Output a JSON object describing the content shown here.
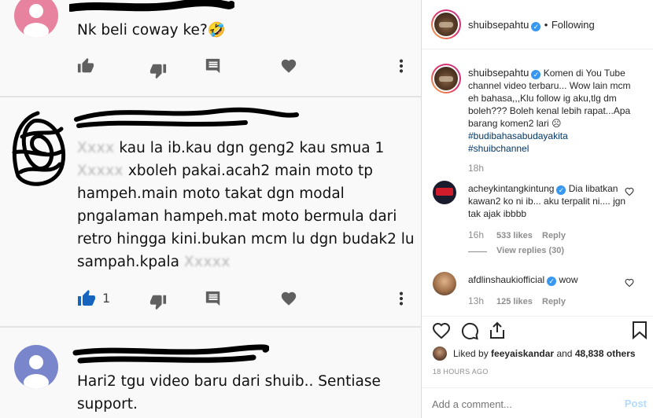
{
  "youtube": {
    "comments": [
      {
        "text": "Nk beli coway ke?",
        "emoji": "🤣"
      },
      {
        "text_parts": [
          "kau la ib.kau dgn geng2 kau smua 1",
          "xboleh pakai.acah2 main moto tp",
          "hampeh.main moto takat dgn modal",
          "pngalaman hampeh.mat moto bermula dari",
          "retro hingga kini.bukan mcm lu dgn budak2 lu",
          "sampah.kpala"
        ],
        "like_count": "1"
      },
      {
        "text": "Hari2 tgu video baru dari shuib.. Sentiase support."
      }
    ],
    "icons": {
      "like": "thumbs-up-icon",
      "dislike": "thumbs-down-icon",
      "reply": "comment-icon",
      "heart": "heart-icon",
      "menu": "more-vertical-icon"
    },
    "colors": {
      "like_active": "#1565c0",
      "icon_grey": "#606060"
    }
  },
  "instagram": {
    "header": {
      "username": "shuibsepahtu",
      "follow_separator": "•",
      "follow_status": "Following"
    },
    "caption": {
      "username": "shuibsepahtu",
      "text": "Komen di You Tube channel video terbaru... Wow lain mcm eh bahasa,,,Klu follow ig aku,tlg dm boleh??? Boleh kenal lebih rapat...Apa barang komen2 lari ☹",
      "hashtags": [
        "#budibahasabudayakita",
        "#shuibchannel"
      ],
      "time": "18h"
    },
    "comments": [
      {
        "username": "acheykintangkintung",
        "text": "Dia libatkan kawan2 ko ni ib... aku terpalit ni.... jgn tak ajak ibbbb",
        "time": "16h",
        "likes": "533 likes",
        "reply": "Reply",
        "view_replies": "View replies (30)"
      },
      {
        "username": "afdlinshaukiofficial",
        "text": "wow",
        "time": "13h",
        "likes": "125 likes",
        "reply": "Reply"
      }
    ],
    "liked_by": {
      "prefix": "Liked by",
      "user": "feeyaiskandar",
      "middle": "and",
      "others": "48,838 others"
    },
    "timestamp": "18 HOURS AGO",
    "add_comment": {
      "placeholder": "Add a comment...",
      "post_label": "Post"
    },
    "colors": {
      "verified": "#3897f0",
      "post_disabled": "#b3dbff"
    }
  }
}
